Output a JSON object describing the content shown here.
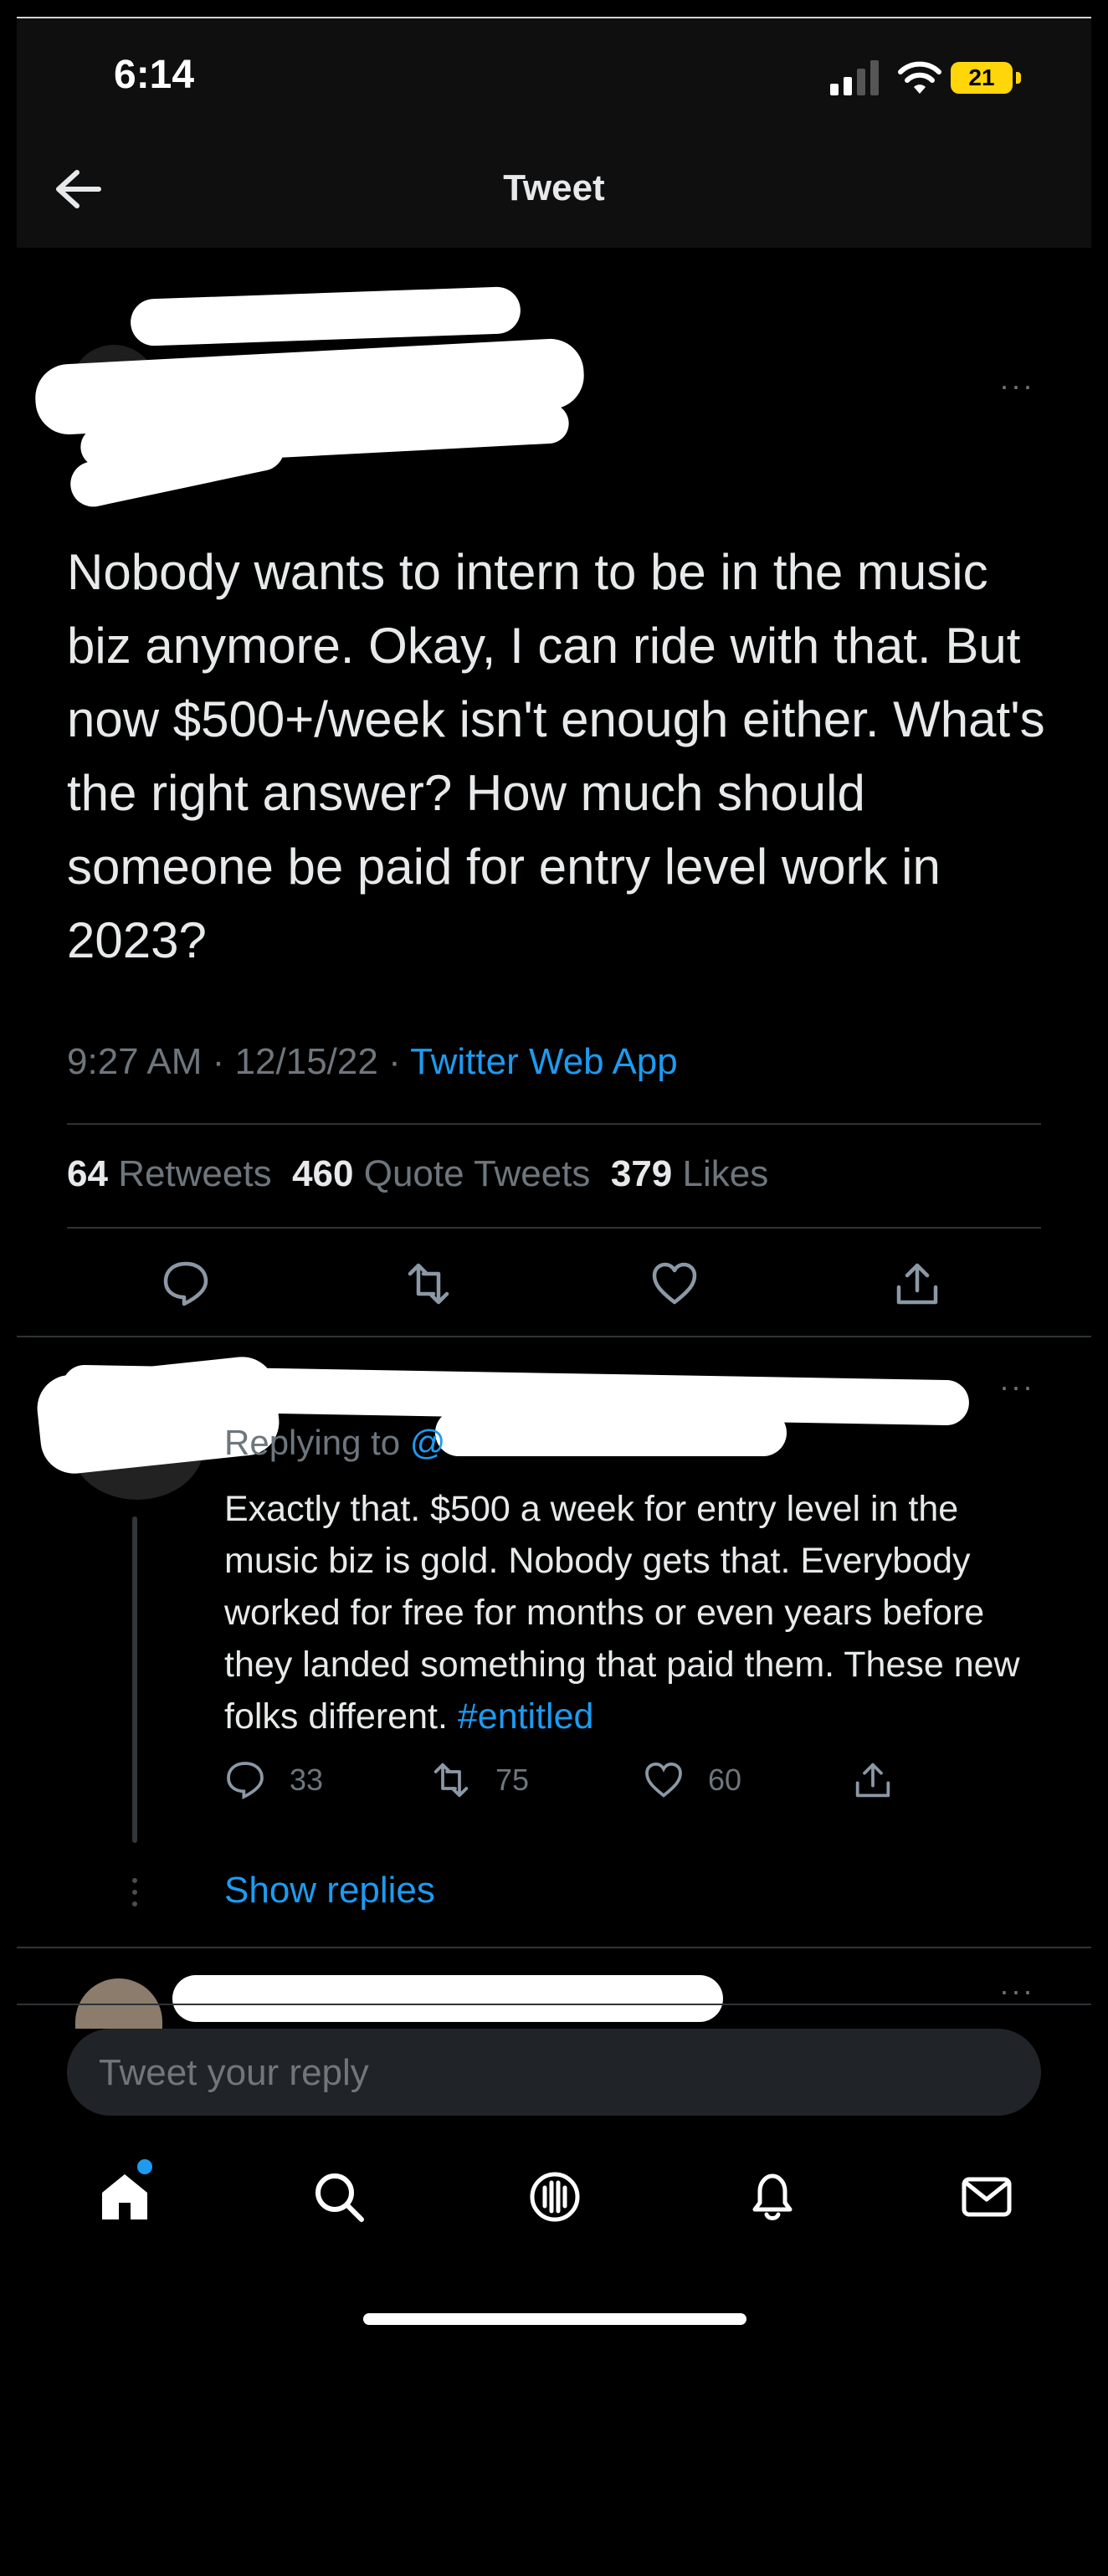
{
  "status_bar": {
    "time": "6:14",
    "battery": "21"
  },
  "header": {
    "title": "Tweet"
  },
  "tweet": {
    "text": "Nobody wants to intern to be in the music biz anymore.  Okay, I can ride with that.  But now $500+/week isn't enough either.  What's the right answer?  How much should someone be paid for entry level work in 2023?",
    "time": "9:27 AM",
    "date": "12/15/22",
    "separator": "·",
    "source": "Twitter Web App",
    "retweets_count": "64",
    "retweets_label": "Retweets",
    "quotes_count": "460",
    "quotes_label": "Quote Tweets",
    "likes_count": "379",
    "likes_label": "Likes"
  },
  "reply": {
    "replying_prefix": "Replying to",
    "replying_handle": "@",
    "text": "Exactly that. $500 a week for entry level in the music biz is gold. Nobody gets that. Everybody worked for free for months or even years before they landed something that paid them. These new folks different.",
    "hashtag": "#entitled",
    "reply_count": "33",
    "retweet_count": "75",
    "like_count": "60",
    "show_replies": "Show replies"
  },
  "composer": {
    "placeholder": "Tweet your reply"
  },
  "icons": {
    "back": "arrow-left-icon",
    "reply": "speech-bubble-icon",
    "retweet": "retweet-icon",
    "like": "heart-icon",
    "share": "share-icon",
    "home": "home-icon",
    "search": "search-icon",
    "spaces": "microphone-icon",
    "notifications": "bell-icon",
    "messages": "envelope-icon"
  },
  "colors": {
    "accent": "#1d9bf0",
    "battery": "#ffd60a"
  }
}
